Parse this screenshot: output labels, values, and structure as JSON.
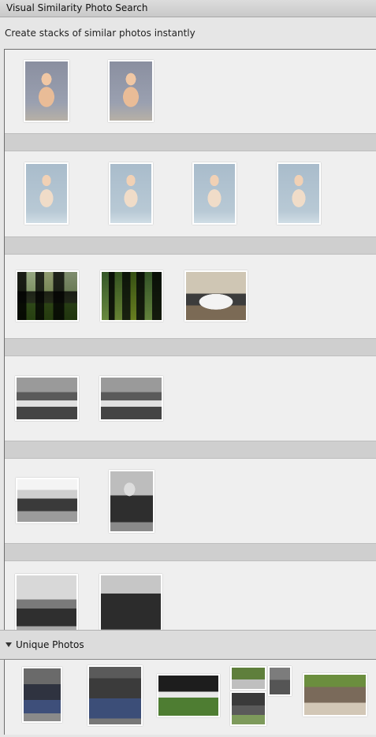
{
  "window": {
    "title": "Visual Similarity Photo Search"
  },
  "subtitle": "Create stacks of similar photos instantly",
  "unique": {
    "label": "Unique Photos"
  }
}
